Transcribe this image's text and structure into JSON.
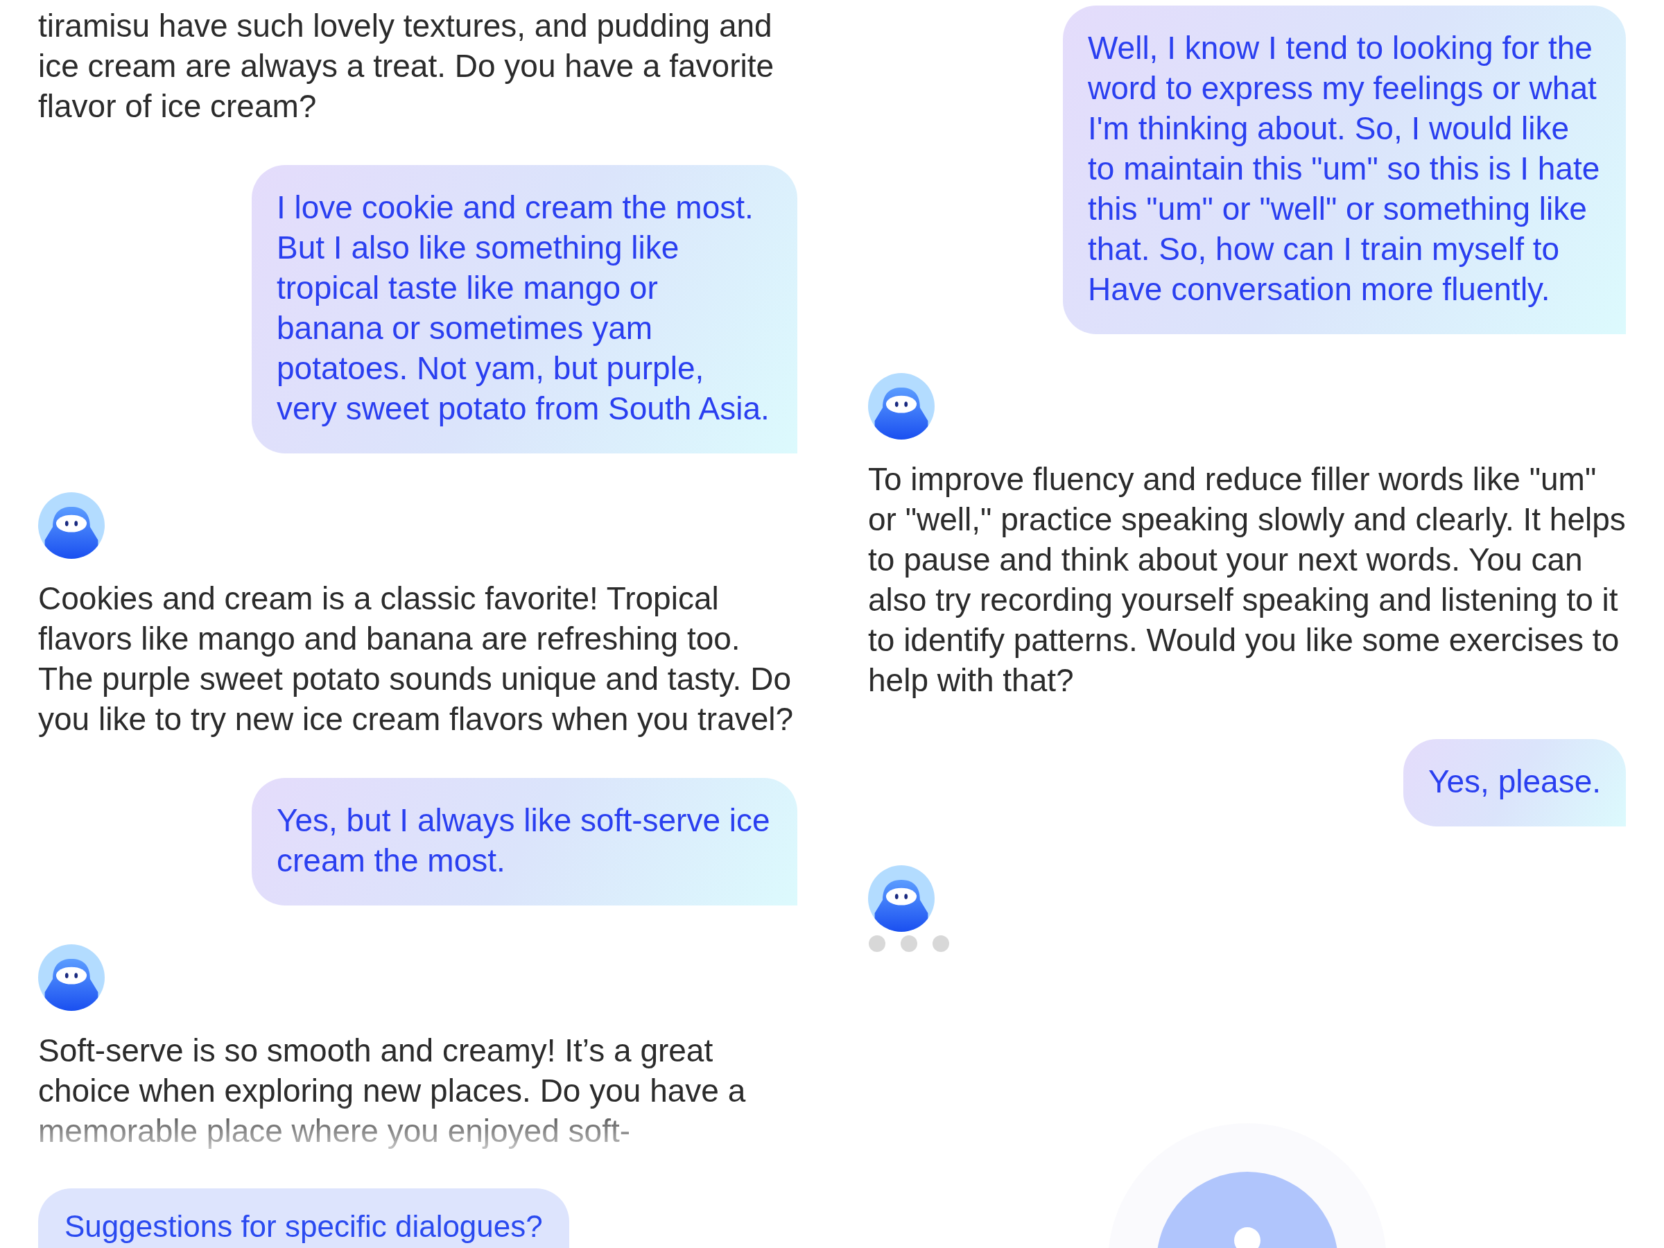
{
  "columns": [
    {
      "messages": [
        {
          "kind": "bot",
          "faded": false,
          "text": "tiramisu have such lovely textures, and pudding and ice cream are always a treat. Do you have a favorite flavor of ice cream?"
        },
        {
          "kind": "user",
          "text": "I love cookie and cream the most. But I also like something like tropical taste like mango or banana or sometimes yam potatoes. Not yam, but purple, very sweet potato from South Asia."
        },
        {
          "kind": "avatar"
        },
        {
          "kind": "bot",
          "faded": false,
          "text": "Cookies and cream is a classic favorite! Tropical flavors like mango and banana are refreshing too. The purple sweet potato sounds unique and tasty. Do you like to try new ice cream flavors when you travel?"
        },
        {
          "kind": "user",
          "text": "Yes, but I always like soft-serve ice cream the most."
        },
        {
          "kind": "avatar"
        },
        {
          "kind": "bot",
          "faded": true,
          "text": "Soft-serve is so smooth and creamy! It’s a great choice when exploring new places. Do you have a memorable place where you enjoyed soft-"
        }
      ],
      "suggestion": "Suggestions for specific dialogues?",
      "mic": false
    },
    {
      "messages": [
        {
          "kind": "user",
          "text": "Well, I know I tend to looking for the word to express my feelings or what I'm thinking about. So, I would like to maintain this \"um\" so this is I hate this \"um\" or \"well\" or something like that. So, how can I train myself to Have conversation more fluently."
        },
        {
          "kind": "avatar"
        },
        {
          "kind": "bot",
          "faded": false,
          "text": "To improve fluency and reduce filler words like \"um\" or \"well,\" practice speaking slowly and clearly. It helps to pause and think about your next words. You can also try recording yourself speaking and listening to it to identify patterns. Would you like some exercises to help with that?"
        },
        {
          "kind": "user",
          "text": "Yes, please."
        },
        {
          "kind": "avatar"
        },
        {
          "kind": "typing"
        }
      ],
      "mic": true
    }
  ]
}
